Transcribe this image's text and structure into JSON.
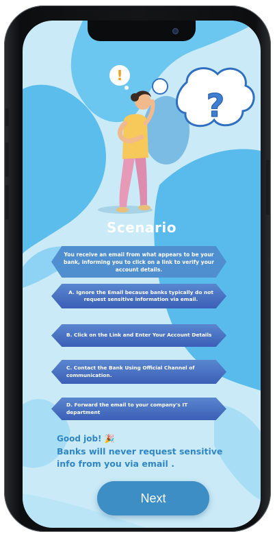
{
  "screen": {
    "title": "Scenario",
    "prompt": "You receive an email from what appears to be your bank, informing you to click on a link to verify your account details.",
    "options": [
      {
        "label": "A.  Ignore the Email because banks typically do not request sensitive information via email."
      },
      {
        "label": "B.  Click on the Link and Enter Your Account Details"
      },
      {
        "label": "C. Contact the Bank Using Official Channel of communication."
      },
      {
        "label": "D. Forward the email to your company's IT department"
      }
    ],
    "feedback": {
      "heading": "Good job! 🎉",
      "message": "Banks will never request sensitive info from you via email ."
    },
    "next_label": "Next"
  },
  "illustration": {
    "thought_bubble_symbol": "?",
    "alert_bubble_symbol": "!"
  },
  "colors": {
    "background": "#c9eaf6",
    "blob": "#4fb8ea",
    "option_fill": "#3b5fb6",
    "feedback_text": "#2f86c4",
    "next_button": "#3d8ec5"
  }
}
